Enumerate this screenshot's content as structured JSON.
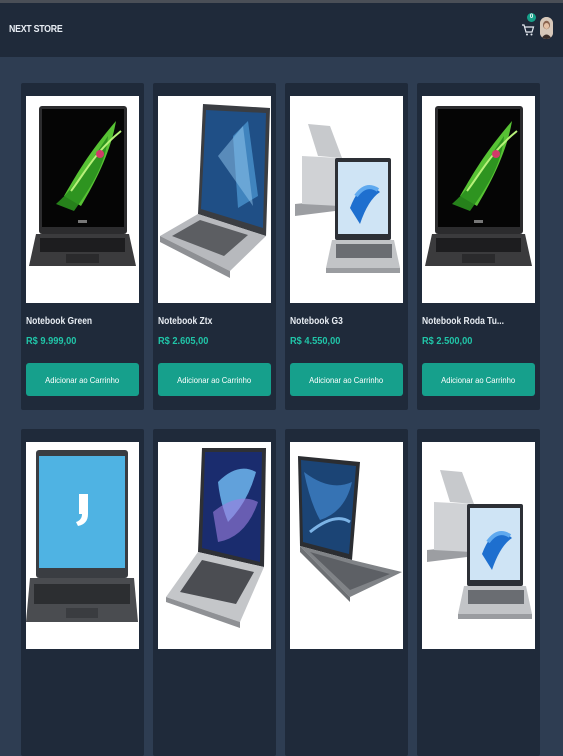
{
  "header": {
    "brand": "NEXT STORE",
    "cart_count": "0",
    "icons": [
      "cart-icon",
      "user-avatar"
    ]
  },
  "colors": {
    "page_bg": "#2e3d52",
    "navbar_bg": "#1f2a3a",
    "card_bg": "#1f2a3a",
    "accent": "#16a08c",
    "price": "#20c5a8"
  },
  "products": [
    {
      "name": "Notebook Green",
      "price": "R$ 9.999,00",
      "button": "Adicionar ao Carrinho",
      "image": "acer-laptop-green-splash"
    },
    {
      "name": "Notebook Ztx",
      "price": "R$ 2.605,00",
      "button": "Adicionar ao Carrinho",
      "image": "silver-laptop-windows10"
    },
    {
      "name": "Notebook G3",
      "price": "R$ 4.550,00",
      "button": "Adicionar ao Carrinho",
      "image": "silver-laptop-windows11-two-views"
    },
    {
      "name": "Notebook Roda Tu...",
      "price": "R$ 2.500,00",
      "button": "Adicionar ao Carrinho",
      "image": "acer-laptop-green-splash"
    },
    {
      "name": "",
      "price": "",
      "button": "",
      "image": "positivo-laptop-blue-screen"
    },
    {
      "name": "",
      "price": "",
      "button": "",
      "image": "silver-laptop-blue-wallpaper"
    },
    {
      "name": "",
      "price": "",
      "button": "",
      "image": "gray-laptop-blue-wallpaper"
    },
    {
      "name": "",
      "price": "",
      "button": "",
      "image": "silver-laptop-windows11-two-views"
    }
  ]
}
